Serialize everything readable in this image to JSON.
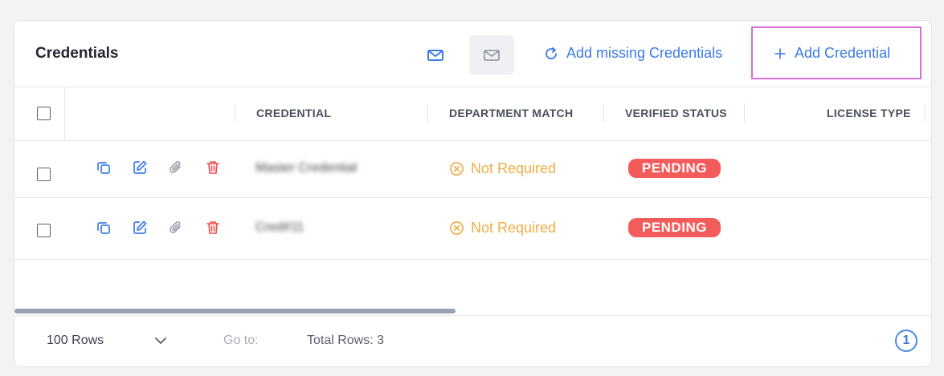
{
  "header": {
    "title": "Credentials",
    "add_missing_label": "Add missing Credentials",
    "add_credential_label": "Add Credential"
  },
  "table": {
    "columns": [
      "CREDENTIAL",
      "DEPARTMENT MATCH",
      "VERIFIED STATUS",
      "LICENSE TYPE"
    ],
    "rows": [
      {
        "credential": "Master Credential",
        "department_match": "Not Required",
        "verified_status": "PENDING",
        "license_type": ""
      },
      {
        "credential": "Cred#11",
        "department_match": "Not Required",
        "verified_status": "PENDING",
        "license_type": ""
      }
    ]
  },
  "footer": {
    "rows_per_page": "100 Rows",
    "goto_label": "Go to:",
    "total_rows": "Total Rows: 3",
    "current_page": "1"
  },
  "colors": {
    "accent": "#3b7be8",
    "warning": "#f0ad45",
    "danger": "#f45b5b",
    "highlight": "#d86cd7"
  },
  "icons": [
    "mail-icon",
    "refresh-icon",
    "plus-icon",
    "copy-icon",
    "edit-icon",
    "attach-icon",
    "trash-icon",
    "x-circle-icon",
    "chevron-down-icon"
  ]
}
